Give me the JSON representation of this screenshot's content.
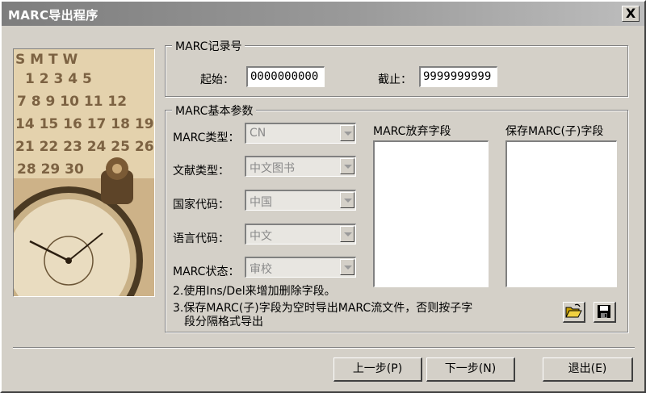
{
  "window": {
    "title": "MARC导出程序",
    "close_symbol": "X"
  },
  "photo_alt": "calendar-and-pocket-watch-photo",
  "calendar_text": {
    "weekdays": "S M T W",
    "row1": "1 2 3 4 5",
    "row2": "7 8 9 10 11 12",
    "row3": "14 15 16 17 18 19",
    "row4": "21 22 23 24 25 26",
    "row5": "28 29 30"
  },
  "record": {
    "group_title": "MARC记录号",
    "start_label": "起始：",
    "start_value": "0000000000",
    "end_label": "截止：",
    "end_value": "9999999999"
  },
  "params": {
    "group_title": "MARC基本参数",
    "fields": [
      {
        "label": "MARC类型：",
        "value": "CN"
      },
      {
        "label": "文献类型：",
        "value": "中文图书"
      },
      {
        "label": "国家代码：",
        "value": "中国"
      },
      {
        "label": "语言代码：",
        "value": "中文"
      },
      {
        "label": "MARC状态：",
        "value": "审校"
      }
    ],
    "discard_label": "MARC放弃字段",
    "keep_label": "保存MARC(子)字段",
    "note1": "2.使用Ins/Del来增加删除字段。",
    "note2_line1": "3.保存MARC(子)字段为空时导出MARC流文件，否则按子字",
    "note2_line2": "段分隔格式导出"
  },
  "icons": {
    "open": "folder-open-icon",
    "save": "floppy-save-icon"
  },
  "buttons": {
    "prev": "上一步(P)",
    "next": "下一步(N)",
    "exit": "退出(E)"
  }
}
